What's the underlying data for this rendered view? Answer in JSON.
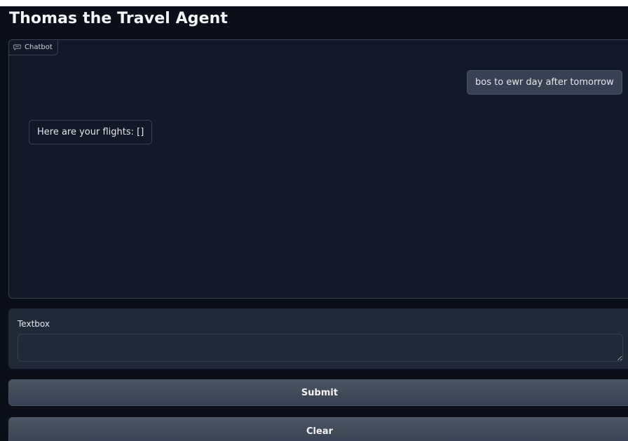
{
  "app": {
    "title": "Thomas the Travel Agent"
  },
  "chatbot": {
    "label": "Chatbot",
    "icon": "chat-bubble-icon",
    "messages": [
      {
        "role": "user",
        "text": "bos to ewr day after tomorrow"
      },
      {
        "role": "bot",
        "text": "Here are your flights: []"
      }
    ]
  },
  "textbox": {
    "label": "Textbox",
    "value": "",
    "placeholder": ""
  },
  "buttons": {
    "submit": "Submit",
    "clear": "Clear"
  },
  "colors": {
    "background": "#0b0f19",
    "panel": "#111827",
    "user_bubble": "#374151",
    "button": "#4b5563"
  }
}
